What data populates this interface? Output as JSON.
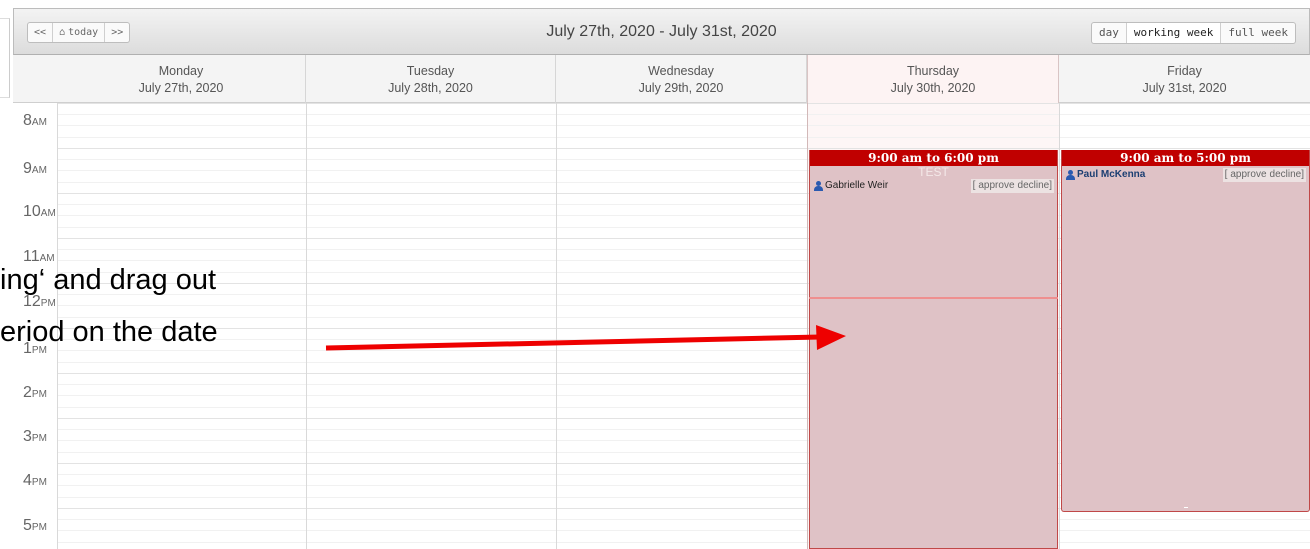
{
  "toolbar": {
    "nav": {
      "prev": "<<",
      "today": "today",
      "next": ">>"
    },
    "range_title": "July 27th, 2020 - July 31st, 2020",
    "views": [
      "day",
      "working week",
      "full week"
    ],
    "active_view": "working week"
  },
  "days": [
    {
      "name": "Monday",
      "date": "July 27th, 2020"
    },
    {
      "name": "Tuesday",
      "date": "July 28th, 2020"
    },
    {
      "name": "Wednesday",
      "date": "July 29th, 2020"
    },
    {
      "name": "Thursday",
      "date": "July 30th, 2020",
      "today": true
    },
    {
      "name": "Friday",
      "date": "July 31st, 2020"
    }
  ],
  "hours": [
    {
      "num": "8",
      "ampm": "AM"
    },
    {
      "num": "9",
      "ampm": "AM"
    },
    {
      "num": "10",
      "ampm": "AM"
    },
    {
      "num": "11",
      "ampm": "AM"
    },
    {
      "num": "12",
      "ampm": "PM"
    },
    {
      "num": "1",
      "ampm": "PM"
    },
    {
      "num": "2",
      "ampm": "PM"
    },
    {
      "num": "3",
      "ampm": "PM"
    },
    {
      "num": "4",
      "ampm": "PM"
    },
    {
      "num": "5",
      "ampm": "PM"
    }
  ],
  "events": [
    {
      "day": "Thursday",
      "time": "9:00 am to 6:00 pm",
      "subject": "TEST",
      "person": "Gabrielle Weir",
      "actions": [
        "approve",
        "decline"
      ]
    },
    {
      "day": "Friday",
      "time": "9:00 am to 5:00 pm",
      "subject": "",
      "person": "Paul McKenna",
      "actions": [
        "approve",
        "decline"
      ]
    }
  ],
  "annotation": {
    "line1": "ing‘ and drag out",
    "line2": "eriod on the date"
  },
  "colors": {
    "event_header": "#c00000",
    "event_body": "#dfc2c6",
    "arrow": "#ee0000"
  }
}
